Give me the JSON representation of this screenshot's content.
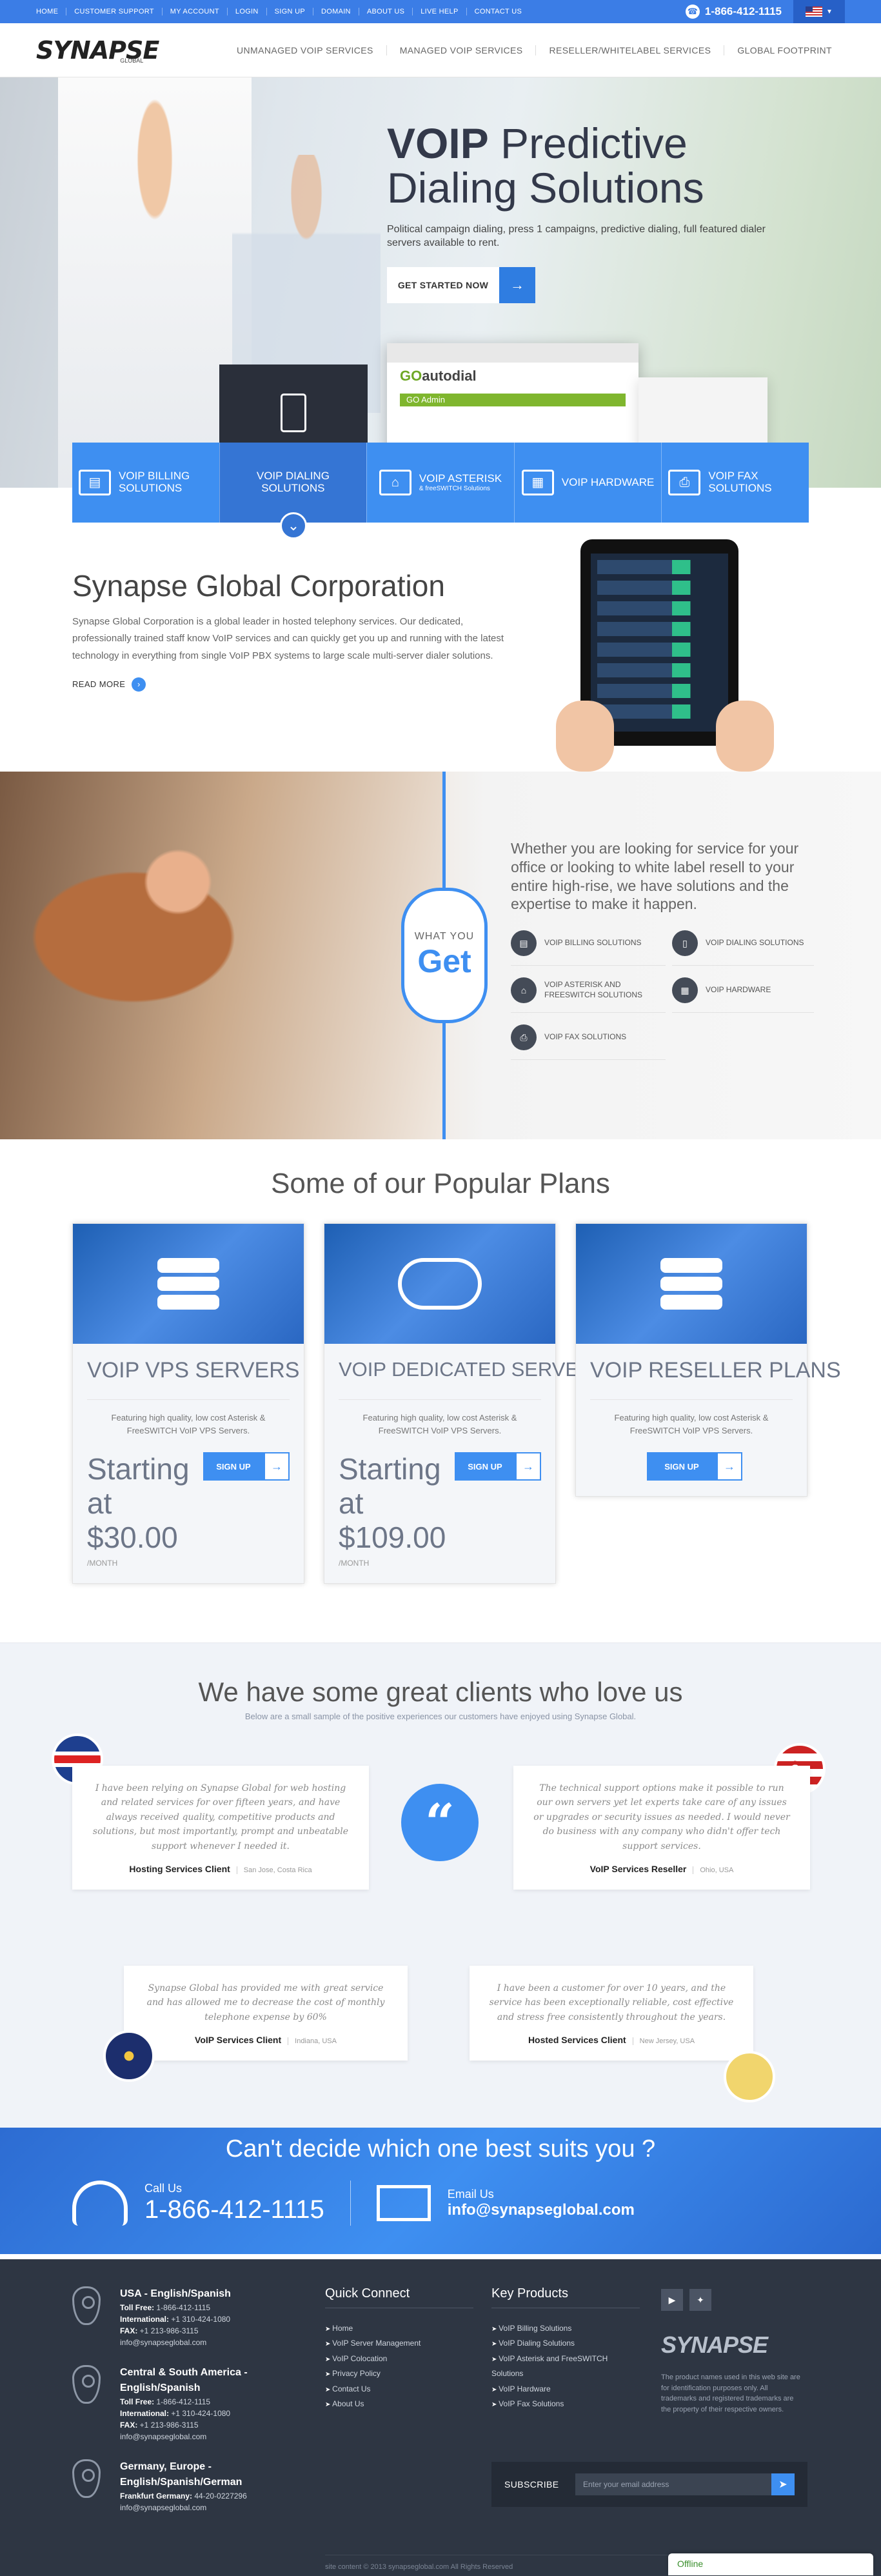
{
  "topbar": {
    "links": [
      "HOME",
      "CUSTOMER SUPPORT",
      "MY ACCOUNT",
      "LOGIN",
      "SIGN UP",
      "DOMAIN",
      "ABOUT US",
      "LIVE HELP",
      "CONTACT US"
    ],
    "phone": "1-866-412-1115"
  },
  "nav": {
    "logo_text": "SYNAPSE",
    "logo_sub": "GLOBAL",
    "items": [
      "UNMANAGED VOIP SERVICES",
      "MANAGED VOIP SERVICES",
      "RESELLER/WHITELABEL SERVICES",
      "GLOBAL FOOTPRINT"
    ]
  },
  "hero": {
    "title_bold": "VOIP",
    "title_rest": " Predictive Dialing Solutions",
    "subtitle": "Political campaign dialing, press 1 campaigns, predictive dialing, full featured dialer servers available to rent.",
    "cta_label": "GET STARTED NOW",
    "screen_title_go": "GO",
    "screen_title_rest": "autodial",
    "screen_bar": "GO Admin"
  },
  "services": [
    {
      "label": "VOIP BILLING SOLUTIONS",
      "sub": ""
    },
    {
      "label": "VOIP DIALING SOLUTIONS",
      "sub": ""
    },
    {
      "label": "VOIP ASTERISK",
      "sub": "& freeSWITCH Solutions"
    },
    {
      "label": "VOIP HARDWARE",
      "sub": ""
    },
    {
      "label": "VOIP FAX SOLUTIONS",
      "sub": ""
    }
  ],
  "corp": {
    "title": "Synapse Global Corporation",
    "desc": "Synapse Global Corporation is a global leader in hosted telephony services. Our dedicated, professionally trained staff know VoIP services and can quickly get you up and running with the latest technology in everything from single VoIP PBX systems to large scale multi-server dialer solutions.",
    "readmore": "READ MORE"
  },
  "wyg": {
    "badge_small": "WHAT YOU",
    "badge_big": "Get",
    "text": "Whether you are looking for service for your office or looking to white label resell to your entire high-rise, we have solutions and the expertise to make it happen.",
    "items": [
      "VOIP BILLING SOLUTIONS",
      "VOIP DIALING SOLUTIONS",
      "VOIP ASTERISK AND FREESWITCH SOLUTIONS",
      "VOIP HARDWARE",
      "VOIP FAX SOLUTIONS"
    ]
  },
  "plans": {
    "title": "Some of our Popular Plans",
    "items": [
      {
        "name": "VOIP VPS SERVERS",
        "feat": "Featuring high quality, low cost Asterisk & FreeSWITCH VoIP VPS Servers.",
        "price": "Starting at $30.00",
        "per": "/MONTH",
        "signup": "SIGN UP"
      },
      {
        "name": "VOIP DEDICATED SERVERS",
        "feat": "Featuring high quality, low cost Asterisk & FreeSWITCH VoIP VPS Servers.",
        "price": "Starting at $109.00",
        "per": "/MONTH",
        "signup": "SIGN UP"
      },
      {
        "name": "VOIP RESELLER PLANS",
        "feat": "Featuring high quality, low cost Asterisk & FreeSWITCH VoIP VPS Servers.",
        "price": "",
        "per": "",
        "signup": "SIGN UP"
      }
    ]
  },
  "clients": {
    "title": "We have some great clients who love us",
    "sub": "Below are a small sample of the positive experiences our customers have enjoyed using Synapse Global.",
    "quote_mark": "“",
    "tests": [
      {
        "q": "I have been relying on Synapse Global for web hosting and related services for over fifteen years, and have always received quality, competitive products and solutions, but most importantly, prompt and unbeatable support whenever I needed it.",
        "who": "Hosting Services Client",
        "loc": "San Jose, Costa Rica"
      },
      {
        "q": "The technical support options make it possible to run our own servers yet let experts take care of any issues or upgrades or security issues as needed. I would never do business with any company who didn't offer tech support services.",
        "who": "VoIP Services Reseller",
        "loc": "Ohio, USA"
      },
      {
        "q": "Synapse Global has provided me with great service and has allowed me to decrease the cost of monthly telephone expense by 60%",
        "who": "VoIP Services Client",
        "loc": "Indiana, USA"
      },
      {
        "q": "I have been a customer for over 10 years, and the service has been exceptionally reliable, cost effective and stress free consistently throughout the years.",
        "who": "Hosted Services Client",
        "loc": "New Jersey, USA"
      }
    ]
  },
  "cta": {
    "title": "Can't decide which one best suits you ?",
    "call_label": "Call Us",
    "call_number": "1-866-412-1115",
    "email_label": "Email Us",
    "email": "info@synapseglobal.com"
  },
  "footer": {
    "locations": [
      {
        "title": "USA - English/Spanish",
        "lines": [
          [
            "Toll Free:",
            " 1-866-412-1115"
          ],
          [
            "International:",
            " +1 310-424-1080"
          ],
          [
            "FAX:",
            " +1 213-986-3115"
          ]
        ],
        "email": "info@synapseglobal.com"
      },
      {
        "title": "Central & South America - English/Spanish",
        "lines": [
          [
            "Toll Free:",
            " 1-866-412-1115"
          ],
          [
            "International:",
            " +1 310-424-1080"
          ],
          [
            "FAX:",
            " +1 213-986-3115"
          ]
        ],
        "email": "info@synapseglobal.com"
      },
      {
        "title": "Germany, Europe - English/Spanish/German",
        "lines": [
          [
            "Frankfurt Germany:",
            " 44-20-0227296"
          ]
        ],
        "email": "info@synapseglobal.com"
      }
    ],
    "quick_title": "Quick Connect",
    "quick": [
      "Home",
      "VoIP Server Management",
      "VoIP Colocation",
      "Privacy Policy",
      "Contact Us",
      "About Us"
    ],
    "products_title": "Key Products",
    "products": [
      "VoIP Billing Solutions",
      "VoIP Dialing Solutions",
      "VoIP Asterisk and FreeSWITCH Solutions",
      "VoIP Hardware",
      "VoIP Fax Solutions"
    ],
    "logo": "SYNAPSE",
    "disclaimer": "The product names used in this web site are for identification purposes only. All trademarks and registered trademarks are the property of their respective owners.",
    "subscribe_label": "SUBSCRIBE",
    "subscribe_placeholder": "Enter your email address",
    "copyright": "site content © 2013 synapseglobal.com All Rights Reserved"
  },
  "chat": {
    "status": "Offline"
  }
}
